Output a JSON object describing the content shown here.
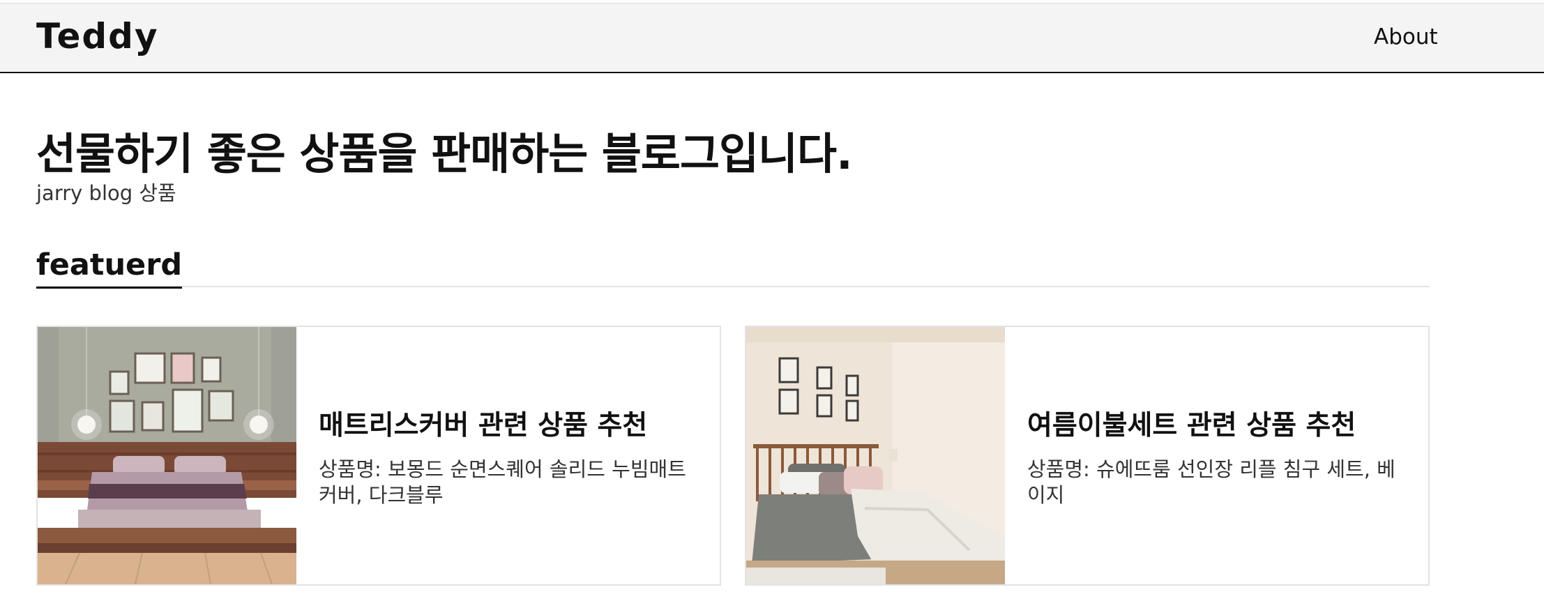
{
  "header": {
    "logo": "Teddy",
    "nav": [
      {
        "label": "About"
      }
    ]
  },
  "hero": {
    "title": "선물하기 좋은 상품을 판매하는 블로그입니다.",
    "subtitle": "jarry blog 상품"
  },
  "featured": {
    "heading": "featuerd",
    "cards": [
      {
        "title": "매트리스커버 관련 상품 추천",
        "description": "상품명: 보몽드 순면스퀘어 솔리드 누빔매트커버, 다크블루",
        "image": "bedroom-photo-wooden-platform-bed"
      },
      {
        "title": "여름이불세트 관련 상품 추천",
        "description": "상품명: 슈에뜨룸 선인장 리플 침구 세트, 베이지",
        "image": "bedroom-photo-spindle-bed"
      }
    ]
  }
}
